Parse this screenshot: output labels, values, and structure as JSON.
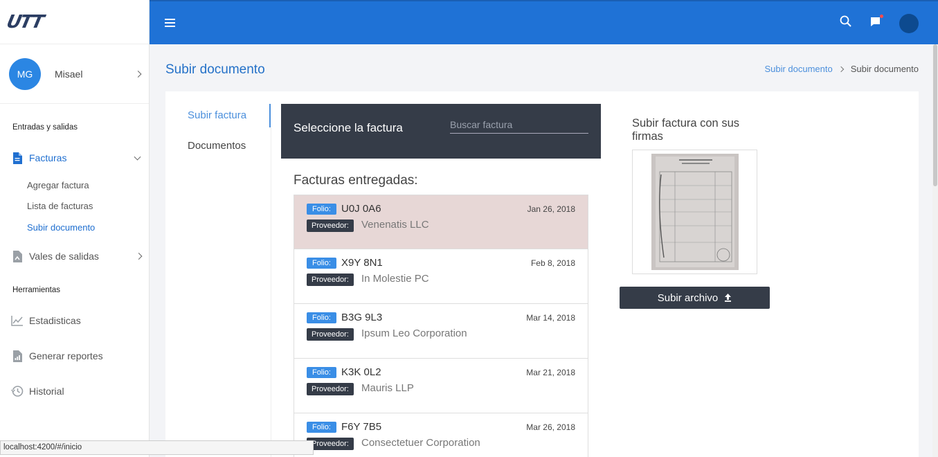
{
  "app": {
    "logo_text": "UTT"
  },
  "user": {
    "initials": "MG",
    "name": "Misael"
  },
  "sidebar": {
    "section1": "Entradas y salidas",
    "facturas": {
      "label": "Facturas",
      "subitems": [
        "Agregar factura",
        "Lista de facturas",
        "Subir documento"
      ]
    },
    "vales": "Vales de salidas",
    "section2": "Herramientas",
    "estadisticas": "Estadisticas",
    "reportes": "Generar reportes",
    "historial": "Historial"
  },
  "header": {
    "title": "Subir documento",
    "breadcrumb": [
      "Subir documento",
      "Subir documento"
    ]
  },
  "tabs": [
    "Subir factura",
    "Documentos"
  ],
  "select_panel": {
    "title": "Seleccione la factura",
    "search_placeholder": "Buscar factura"
  },
  "list": {
    "title": "Facturas entregadas:",
    "folio_label": "Folio:",
    "provider_label": "Proveedor:",
    "items": [
      {
        "folio": "U0J 0A6",
        "date": "Jan 26, 2018",
        "provider": "Venenatis LLC",
        "selected": true
      },
      {
        "folio": "X9Y 8N1",
        "date": "Feb 8, 2018",
        "provider": "In Molestie PC"
      },
      {
        "folio": "B3G 9L3",
        "date": "Mar 14, 2018",
        "provider": "Ipsum Leo Corporation"
      },
      {
        "folio": "K3K 0L2",
        "date": "Mar 21, 2018",
        "provider": "Mauris LLP"
      },
      {
        "folio": "F6Y 7B5",
        "date": "Mar 26, 2018",
        "provider": "Consectetuer Corporation"
      }
    ]
  },
  "upload": {
    "title": "Subir factura con sus firmas",
    "button_label": "Subir archivo"
  },
  "status_bar": "localhost:4200/#/inicio",
  "colors": {
    "primary": "#1f72d6",
    "dark": "#353c48",
    "selected_row": "#e7d7d6"
  }
}
